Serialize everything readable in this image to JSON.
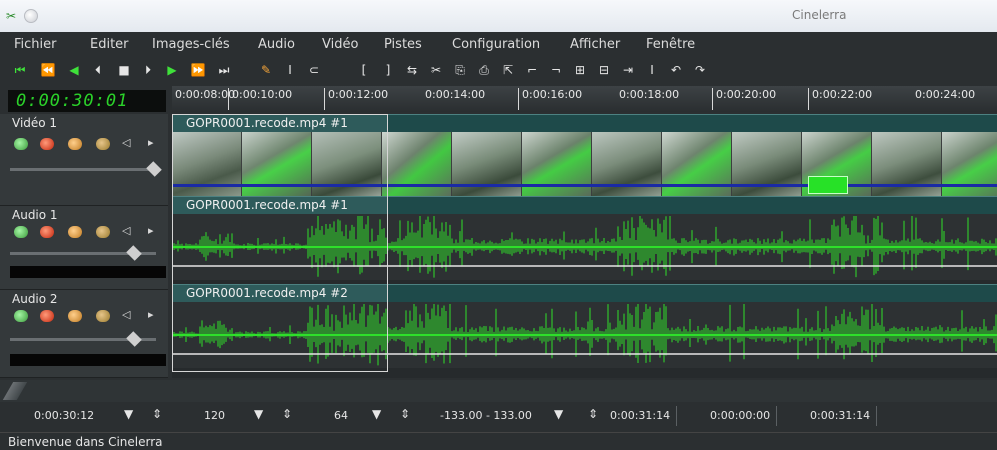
{
  "window": {
    "title": "Cinelerra"
  },
  "menu": [
    "Fichier",
    "Editer",
    "Images-clés",
    "Audio",
    "Vidéo",
    "Pistes",
    "Configuration",
    "Afficher",
    "Fenêtre"
  ],
  "toolbar": {
    "transport": [
      "⏮",
      "⏪",
      "◀",
      "⏴",
      "■",
      "⏵",
      "▶",
      "⏩",
      "⏭"
    ],
    "edit": [
      "✎",
      "I",
      "⊂"
    ],
    "tools": [
      "[",
      "]",
      "⇆",
      "✂",
      "⎘",
      "⎙",
      "⇱",
      "⌐",
      "¬",
      "⊞",
      "⊟",
      "⇥",
      "I",
      "↶",
      "↷"
    ]
  },
  "clock": "0:00:30:01",
  "timeline": {
    "ticks": [
      "0:00:08:00",
      "0:00:10:00",
      "0:00:12:00",
      "0:00:14:00",
      "0:00:16:00",
      "0:00:18:00",
      "0:00:20:00",
      "0:00:22:00",
      "0:00:24:00"
    ]
  },
  "tracks": [
    {
      "name": "Vidéo 1",
      "edit": "GOPR0001.recode.mp4 #1"
    },
    {
      "name": "Audio 1",
      "edit": "GOPR0001.recode.mp4 #1"
    },
    {
      "name": "Audio 2",
      "edit": "GOPR0001.recode.mp4 #2"
    }
  ],
  "bottom": {
    "position": "0:00:30:12",
    "zoom_samples": "120",
    "zoom_tracks": "64",
    "amp_range": "-133.00 - 133.00",
    "sel_start": "0:00:31:14",
    "sel_length": "0:00:00:00",
    "sel_end": "0:00:31:14"
  },
  "status": "Bienvenue dans Cinelerra",
  "colors": {
    "wave": "#2ee02a",
    "clock": "#2bd22a",
    "panel": "#2b2f31"
  }
}
